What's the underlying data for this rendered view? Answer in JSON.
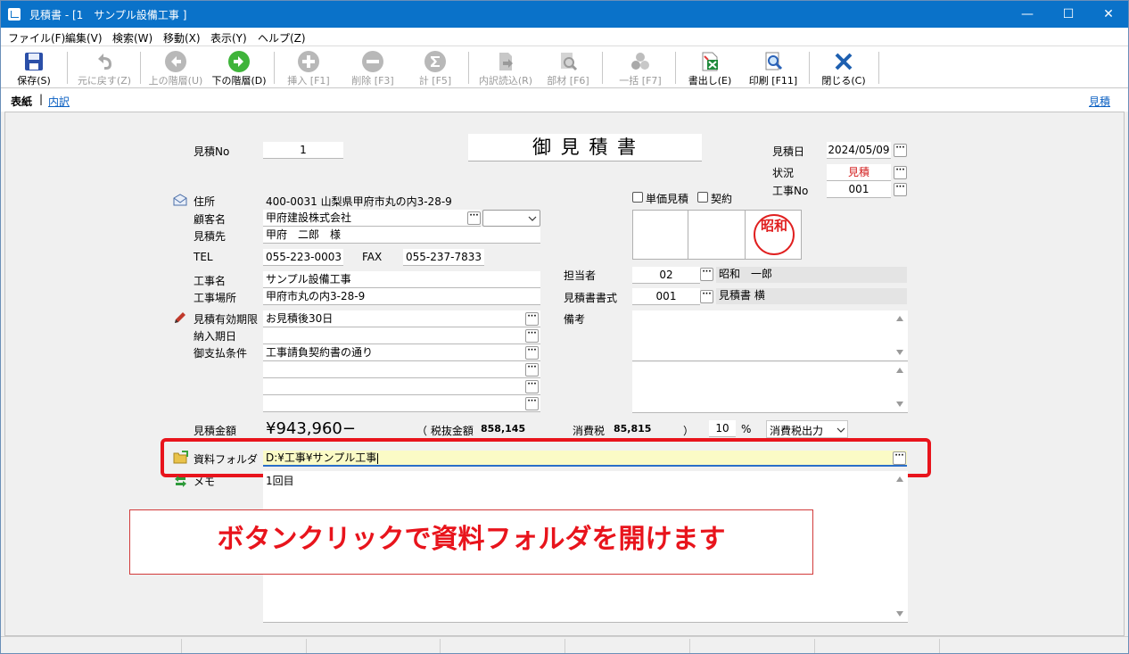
{
  "window": {
    "title": "見積書 - [1　サンプル設備工事 ]",
    "minimize": "—",
    "maximize": "☐",
    "close": "✕"
  },
  "menu": [
    "ファイル(F)",
    "編集(V)",
    "検索(W)",
    "移動(X)",
    "表示(Y)",
    "ヘルプ(Z)"
  ],
  "toolbar": {
    "save": "保存(S)",
    "undo": "元に戻す(Z)",
    "up": "上の階層(U)",
    "down": "下の階層(D)",
    "insert": "挿入 [F1]",
    "delete": "削除 [F3]",
    "total": "計 [F5]",
    "load": "内訳読込(R)",
    "parts": "部材 [F6]",
    "batch": "一括 [F7]",
    "export": "書出し(E)",
    "print": "印刷 [F11]",
    "close": "閉じる(C)"
  },
  "tabs": {
    "cover": "表紙",
    "sep": "|",
    "detail": "内訳",
    "right_link": "見積"
  },
  "form": {
    "estimate_no_label": "見積No",
    "estimate_no": "1",
    "doc_title": "御 見 積 書",
    "date_label": "見積日",
    "date": "2024/05/09",
    "status_label": "状況",
    "status": "見積",
    "job_no_label": "工事No",
    "job_no": "001",
    "address_label": "住所",
    "address": "400-0031 山梨県甲府市丸の内3-28-9",
    "customer_label": "顧客名",
    "customer": "甲府建設株式会社",
    "recipient_label": "見積先",
    "recipient": "甲府　二郎　様",
    "tel_label": "TEL",
    "tel": "055-223-0003",
    "fax_label": "FAX",
    "fax": "055-237-7833",
    "unit_price_label": "単価見積",
    "contract_label": "契約",
    "stamp_text": "昭和",
    "job_name_label": "工事名",
    "job_name": "サンプル設備工事",
    "site_label": "工事場所",
    "site": "甲府市丸の内3-28-9",
    "person_label": "担当者",
    "person_code": "02",
    "person_name": "昭和　一郎",
    "format_label": "見積書書式",
    "format_code": "001",
    "format_name": "見積書 横",
    "validity_label": "見積有効期限",
    "validity": "お見積後30日",
    "delivery_label": "納入期日",
    "delivery": "",
    "payment_label": "御支払条件",
    "payment": "工事請負契約書の通り",
    "notes_label": "備考",
    "amount_label": "見積金額",
    "amount": "¥943,960−",
    "tax_excl_open": "（ 税抜金額",
    "tax_excl": "858,145",
    "tax_label": "消費税",
    "tax": "85,815",
    "tax_close": "）",
    "tax_rate": "10",
    "percent": "%",
    "tax_mode": "消費税出力",
    "folder_label": "資料フォルダ",
    "folder_value": "D:¥工事¥サンプル工事",
    "memo_label": "メモ",
    "memo": "1回目"
  },
  "annotation": {
    "callout": "ボタンクリックで資料フォルダを開けます",
    "highlight_color": "#e8141c"
  }
}
